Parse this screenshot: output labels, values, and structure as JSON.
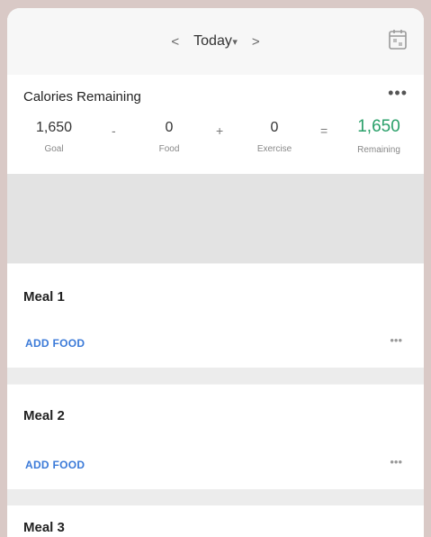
{
  "header": {
    "prev_label": "<",
    "date_label": "Today",
    "dropdown_caret": "▾",
    "next_label": ">",
    "calendar_icon": "calendar-icon"
  },
  "summary": {
    "title": "Calories Remaining",
    "more_label": "•••",
    "goal_value": "1,650",
    "goal_label": "Goal",
    "op_minus": "-",
    "food_value": "0",
    "food_label": "Food",
    "op_plus": "+",
    "exercise_value": "0",
    "exercise_label": "Exercise",
    "op_equals": "=",
    "remaining_value": "1,650",
    "remaining_label": "Remaining"
  },
  "colors": {
    "remaining": "#2aa06a",
    "add_food": "#3b7ad8"
  },
  "meals": [
    {
      "title": "Meal 1",
      "add_label": "ADD FOOD",
      "more_label": "•••"
    },
    {
      "title": "Meal 2",
      "add_label": "ADD FOOD",
      "more_label": "•••"
    },
    {
      "title": "Meal 3"
    }
  ]
}
